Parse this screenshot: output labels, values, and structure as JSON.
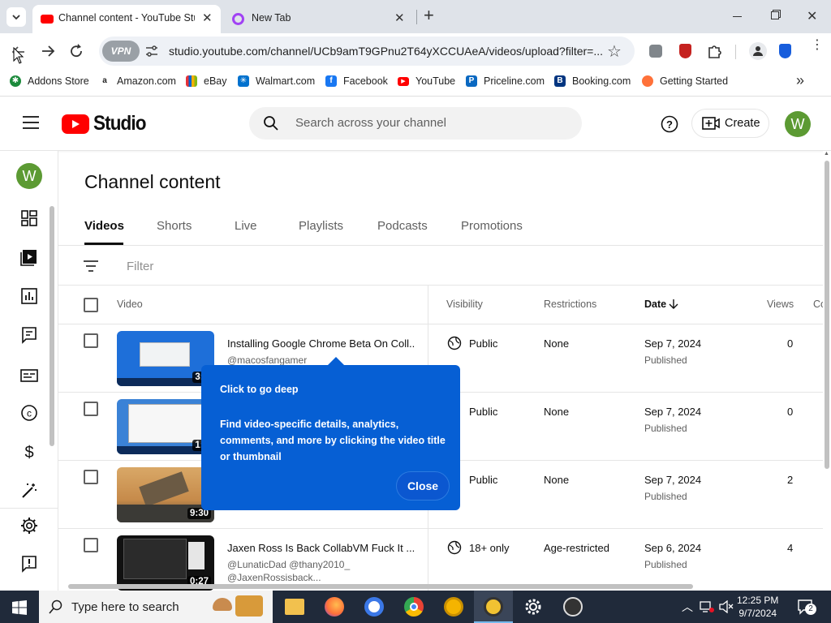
{
  "browser": {
    "tabs": [
      {
        "title": "Channel content - YouTube Stu",
        "active": true
      },
      {
        "title": "New Tab",
        "active": false
      }
    ],
    "new_tab_symbol": "+",
    "vpn_label": "VPN",
    "url": "studio.youtube.com/channel/UCb9amT9GPnu2T64yXCCUAeA/videos/upload?filter=...",
    "bookmarks": [
      {
        "label": "Addons Store",
        "color": "#1b8a3b"
      },
      {
        "label": "Amazon.com",
        "color": "#222222"
      },
      {
        "label": "eBay",
        "color": "#e53238"
      },
      {
        "label": "Walmart.com",
        "color": "#0071ce"
      },
      {
        "label": "Facebook",
        "color": "#1877f2"
      },
      {
        "label": "YouTube",
        "color": "#ff0000"
      },
      {
        "label": "Priceline.com",
        "color": "#0a68c1"
      },
      {
        "label": "Booking.com",
        "color": "#003580"
      },
      {
        "label": "Getting Started",
        "color": "#ff7139"
      }
    ],
    "bookmarks_overflow": "»"
  },
  "studio": {
    "logo_text": "Studio",
    "search_placeholder": "Search across your channel",
    "create_label": "Create",
    "avatar_letter": "W",
    "page_title": "Channel content",
    "tabs": [
      "Videos",
      "Shorts",
      "Live",
      "Playlists",
      "Podcasts",
      "Promotions"
    ],
    "active_tab": "Videos",
    "filter_placeholder": "Filter",
    "columns": {
      "video": "Video",
      "visibility": "Visibility",
      "restrictions": "Restrictions",
      "date": "Date",
      "views": "Views",
      "comments": "Co"
    },
    "rows": [
      {
        "title": "Installing Google Chrome Beta On Coll...",
        "subtitle": "@macosfangamer",
        "subtitle2": "",
        "duration": "3:0",
        "visibility": "Public",
        "restrictions": "None",
        "date": "Sep 7, 2024",
        "status": "Published",
        "views": "0"
      },
      {
        "title": "",
        "subtitle": "",
        "subtitle2": "",
        "duration": "1:1",
        "visibility": "Public",
        "restrictions": "None",
        "date": "Sep 7, 2024",
        "status": "Published",
        "views": "0"
      },
      {
        "title": "",
        "subtitle": "",
        "subtitle2": "",
        "duration": "9:30",
        "visibility": "Public",
        "restrictions": "None",
        "date": "Sep 7, 2024",
        "status": "Published",
        "views": "2"
      },
      {
        "title": "Jaxen Ross Is Back CollabVM Fuck It ...",
        "subtitle": "@LunaticDad @thany2010_",
        "subtitle2": "@JaxenRossisback...",
        "duration": "0:27",
        "visibility": "18+ only",
        "restrictions": "Age-restricted",
        "date": "Sep 6, 2024",
        "status": "Published",
        "views": "4"
      }
    ],
    "popup": {
      "title": "Click to go deep",
      "body": "Find video-specific details, analytics, comments, and more by clicking the video title or thumbnail",
      "close_label": "Close"
    }
  },
  "taskbar": {
    "search_placeholder": "Type here to search",
    "time": "12:25 PM",
    "date": "9/7/2024",
    "notification_count": "2"
  },
  "colors": {
    "accent_blue": "#065fd4",
    "youtube_red": "#ff0000",
    "avatar_green": "#5c9a33"
  }
}
